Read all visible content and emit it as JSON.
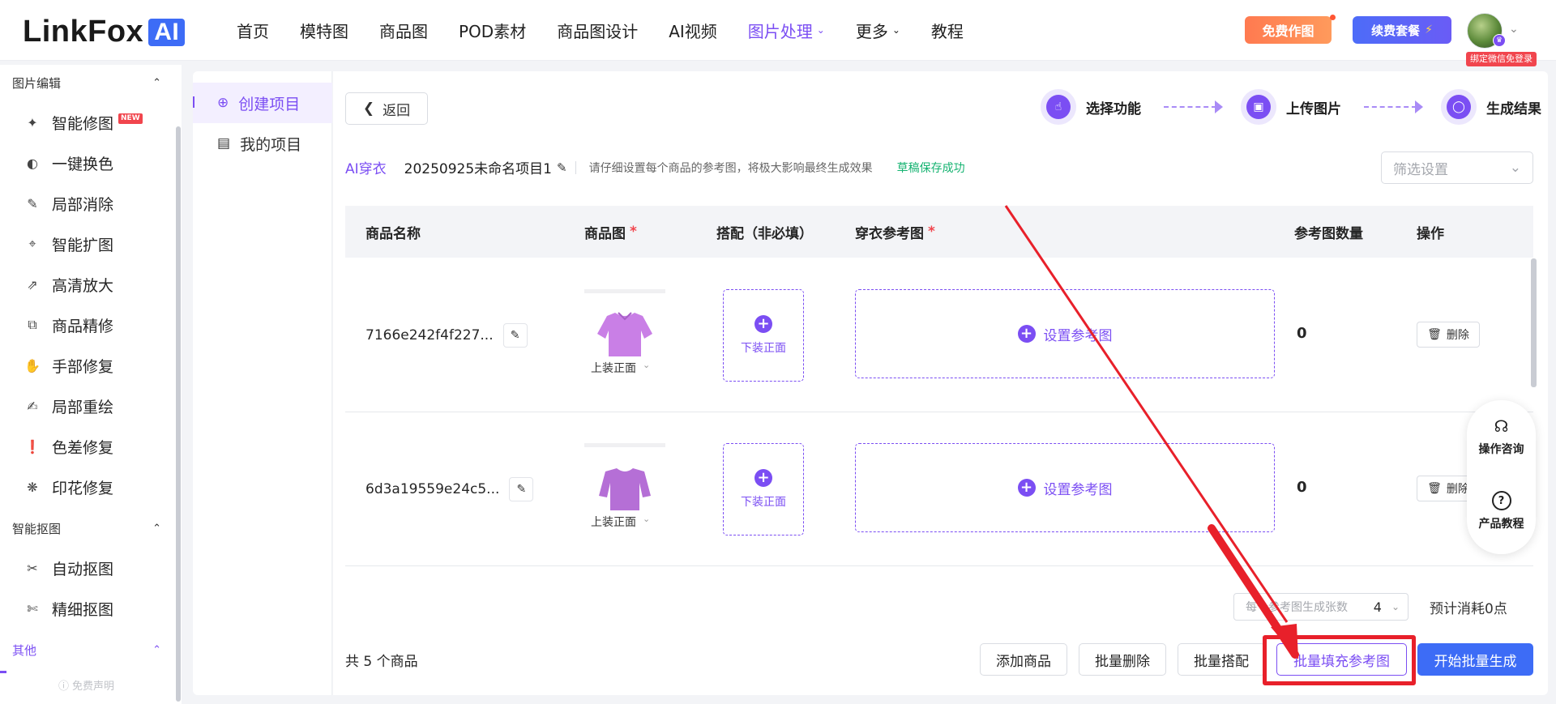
{
  "header": {
    "logo_text": "LinkFox",
    "logo_ai": "AI",
    "nav": [
      {
        "label": "首页",
        "active": false
      },
      {
        "label": "模特图",
        "active": false
      },
      {
        "label": "商品图",
        "active": false
      },
      {
        "label": "POD素材",
        "active": false
      },
      {
        "label": "商品图设计",
        "active": false
      },
      {
        "label": "AI视频",
        "active": false
      },
      {
        "label": "图片处理",
        "active": true,
        "dropdown": true
      },
      {
        "label": "更多",
        "active": false,
        "dropdown": true
      },
      {
        "label": "教程",
        "active": false
      }
    ],
    "free_button": "免费作图",
    "renew_button": "续费套餐",
    "wechat_tag": "绑定微信免登录"
  },
  "sidebar": {
    "groups": [
      {
        "title": "图片编辑",
        "items": [
          {
            "label": "智能修图",
            "icon": "magic-wand-icon",
            "badge": "NEW"
          },
          {
            "label": "一键换色",
            "icon": "color-swap-icon"
          },
          {
            "label": "局部消除",
            "icon": "eraser-icon"
          },
          {
            "label": "智能扩图",
            "icon": "expand-icon"
          },
          {
            "label": "高清放大",
            "icon": "upscale-icon"
          },
          {
            "label": "商品精修",
            "icon": "retouch-icon"
          },
          {
            "label": "手部修复",
            "icon": "hand-icon"
          },
          {
            "label": "局部重绘",
            "icon": "repaint-icon"
          },
          {
            "label": "色差修复",
            "icon": "color-fix-icon"
          },
          {
            "label": "印花修复",
            "icon": "print-fix-icon"
          }
        ]
      },
      {
        "title": "智能抠图",
        "items": [
          {
            "label": "自动抠图",
            "icon": "auto-cutout-icon"
          },
          {
            "label": "精细抠图",
            "icon": "fine-cutout-icon"
          }
        ]
      },
      {
        "title": "其他",
        "items": []
      }
    ],
    "disclaimer": "免费声明"
  },
  "project_panel": {
    "items": [
      {
        "label": "创建项目",
        "active": true
      },
      {
        "label": "我的项目",
        "active": false
      }
    ]
  },
  "main": {
    "back_button": "返回",
    "steps": [
      "选择功能",
      "上传图片",
      "生成结果"
    ],
    "tag": "AI穿衣",
    "project_name": "20250925未命名项目1",
    "hint": "请仔细设置每个商品的参考图，将极大影响最终生成效果",
    "saved_status": "草稿保存成功",
    "filter_placeholder": "筛选设置",
    "table": {
      "headers": [
        "商品名称",
        "商品图",
        "搭配（非必填）",
        "穿衣参考图",
        "参考图数量",
        "操作"
      ],
      "rows": [
        {
          "name": "7166e242f4f227...",
          "product_select": "上装正面",
          "match_label": "下装正面",
          "ref_label": "设置参考图",
          "count": "0",
          "delete": "删除",
          "shirt_color": "#c97fe6"
        },
        {
          "name": "6d3a19559e24c5...",
          "product_select": "上装正面",
          "match_label": "下装正面",
          "ref_label": "设置参考图",
          "count": "0",
          "delete": "删除",
          "shirt_color": "#b56fd6"
        }
      ]
    },
    "generate_count_label": "每个参考图生成张数",
    "generate_count_value": "4",
    "cost_text": "预计消耗0点",
    "total_text": "共 5 个商品",
    "buttons": {
      "add": "添加商品",
      "batch_delete": "批量删除",
      "batch_match": "批量搭配",
      "batch_fill": "批量填充参考图",
      "start": "开始批量生成"
    }
  },
  "float_panel": {
    "consult": "操作咨询",
    "tutorial": "产品教程"
  },
  "colors": {
    "accent": "#7b4ef3",
    "primary": "#3d6cf6",
    "annotation": "#e8202a"
  }
}
